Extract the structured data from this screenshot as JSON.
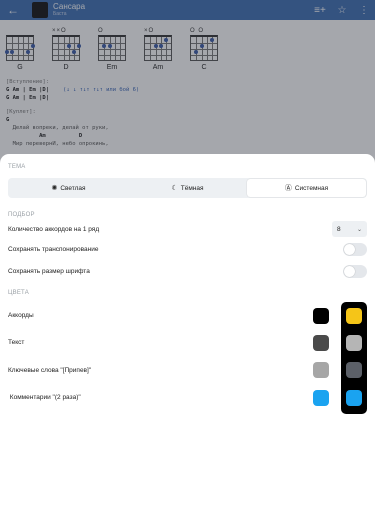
{
  "app": {
    "song_title": "Сансара",
    "song_artist": "Баста",
    "chords": [
      {
        "name": "G",
        "top": "",
        "dots": [
          [
            0,
            2
          ],
          [
            1,
            2
          ],
          [
            4,
            2
          ],
          [
            5,
            1
          ]
        ]
      },
      {
        "name": "D",
        "top": "××O",
        "dots": [
          [
            3,
            1
          ],
          [
            4,
            2
          ],
          [
            5,
            1
          ]
        ]
      },
      {
        "name": "Em",
        "top": "O",
        "dots": [
          [
            1,
            1
          ],
          [
            2,
            1
          ]
        ]
      },
      {
        "name": "Am",
        "top": "×O",
        "dots": [
          [
            2,
            1
          ],
          [
            3,
            1
          ],
          [
            4,
            0
          ]
        ]
      },
      {
        "name": "C",
        "top": "O  O",
        "dots": [
          [
            1,
            2
          ],
          [
            2,
            1
          ],
          [
            4,
            0
          ]
        ]
      }
    ],
    "lyrics": {
      "intro_label": "[Вступление]:",
      "intro_line1_chords": "G  Am | Em  |D|",
      "intro_line1_tab": "(↓ ↓ ↑↓↑ ↑↓↑ или бой 6)",
      "intro_line2_chords": "G  Am | Em  |D|",
      "verse_label": "[Куплет]:",
      "verse_chord": "G",
      "verse_line1": "  Делай вопреки, делай от руки,",
      "verse_line2_chords": "          Am          D",
      "verse_line3": "  Мир перевернИ, небо опрокинь,"
    }
  },
  "sheet": {
    "theme_label": "ТЕМА",
    "theme_options": [
      {
        "label": "Светлая",
        "icon": "sun-icon",
        "glyph": "✺"
      },
      {
        "label": "Тёмная",
        "icon": "moon-icon",
        "glyph": "☾"
      },
      {
        "label": "Системная",
        "icon": "auto-theme-icon",
        "glyph": "Ⓐ"
      }
    ],
    "theme_selected": "Системная",
    "selection_label": "ПОДБОР",
    "chords_per_row_label": "Количество аккордов на 1 ряд",
    "chords_per_row_value": "8",
    "save_transpose_label": "Сохранять транспонирование",
    "save_transpose_on": false,
    "save_font_label": "Сохранять размер шрифта",
    "save_font_on": false,
    "colors_label": "ЦВЕТА",
    "color_rows": [
      {
        "label": "Аккорды",
        "light": "#000000",
        "dark": "#f5c518"
      },
      {
        "label": "Текст",
        "light": "#4a4a4a",
        "dark": "#b5b5b5"
      },
      {
        "label": "Ключевые слова \"[Припев]\"",
        "light": "#a6a6a6",
        "dark": "#5c6068"
      },
      {
        "label": " Комментарии \"(2 раза)\"",
        "light": "#1aa3f0",
        "dark": "#1aa3f0"
      }
    ]
  }
}
